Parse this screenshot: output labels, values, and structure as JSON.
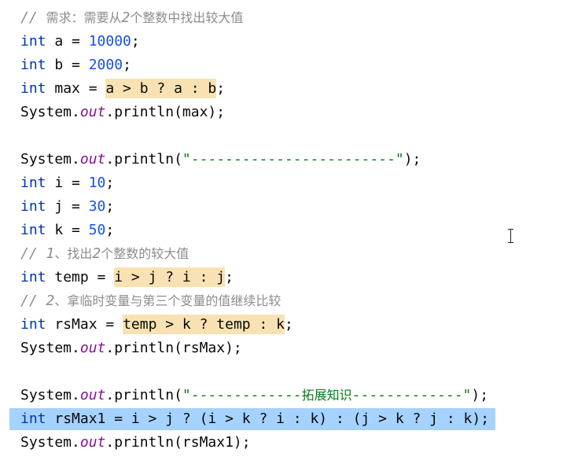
{
  "editor": {
    "lines": [
      [
        {
          "t": "// 需求：需要从2个整数中找出较大值",
          "c": "cmt"
        }
      ],
      [
        {
          "t": "int",
          "c": "kw"
        },
        {
          "t": " a = "
        },
        {
          "t": "10000",
          "c": "num"
        },
        {
          "t": ";"
        }
      ],
      [
        {
          "t": "int",
          "c": "kw"
        },
        {
          "t": " b = "
        },
        {
          "t": "2000",
          "c": "num"
        },
        {
          "t": ";"
        }
      ],
      [
        {
          "t": "int",
          "c": "kw"
        },
        {
          "t": " max = "
        },
        {
          "t": "a > b ? a : b",
          "c": "hl"
        },
        {
          "t": ";"
        }
      ],
      [
        {
          "t": "System."
        },
        {
          "t": "out",
          "c": "fld"
        },
        {
          "t": ".println(max);"
        }
      ],
      [],
      [
        {
          "t": "System."
        },
        {
          "t": "out",
          "c": "fld"
        },
        {
          "t": ".println("
        },
        {
          "t": "\"------------------------\"",
          "c": "str"
        },
        {
          "t": ");"
        }
      ],
      [
        {
          "t": "int",
          "c": "kw"
        },
        {
          "t": " i = "
        },
        {
          "t": "10",
          "c": "num"
        },
        {
          "t": ";"
        }
      ],
      [
        {
          "t": "int",
          "c": "kw"
        },
        {
          "t": " j = "
        },
        {
          "t": "30",
          "c": "num"
        },
        {
          "t": ";"
        }
      ],
      [
        {
          "t": "int",
          "c": "kw"
        },
        {
          "t": " k = "
        },
        {
          "t": "50",
          "c": "num"
        },
        {
          "t": ";"
        }
      ],
      [
        {
          "t": "// 1、找出2个整数的较大值",
          "c": "cmt"
        }
      ],
      [
        {
          "t": "int",
          "c": "kw"
        },
        {
          "t": " temp = "
        },
        {
          "t": "i > j ? i : j",
          "c": "hl"
        },
        {
          "t": ";"
        }
      ],
      [
        {
          "t": "// 2、拿临时变量与第三个变量的值继续比较",
          "c": "cmt"
        }
      ],
      [
        {
          "t": "int",
          "c": "kw"
        },
        {
          "t": " rsMax = "
        },
        {
          "t": "temp > k ? temp : k",
          "c": "hl"
        },
        {
          "t": ";"
        }
      ],
      [
        {
          "t": "System."
        },
        {
          "t": "out",
          "c": "fld"
        },
        {
          "t": ".println(rsMax);"
        }
      ],
      [],
      [
        {
          "t": "System."
        },
        {
          "t": "out",
          "c": "fld"
        },
        {
          "t": ".println("
        },
        {
          "t": "\"-------------拓展知识-------------\"",
          "c": "str"
        },
        {
          "t": ");"
        }
      ],
      [
        {
          "t": "int",
          "c": "kw"
        },
        {
          "t": " rsMax1 = i > j ? (i > k ? i : k) : (j > k ? j : k);"
        }
      ],
      [
        {
          "t": "System."
        },
        {
          "t": "out",
          "c": "fld"
        },
        {
          "t": ".println(rsMax1);"
        }
      ]
    ],
    "active_line_index": 17
  }
}
